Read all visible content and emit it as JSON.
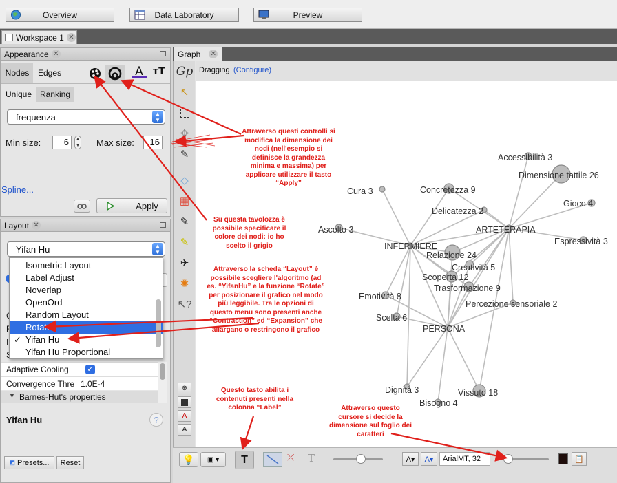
{
  "top": {
    "overview": "Overview",
    "data_lab": "Data Laboratory",
    "preview": "Preview"
  },
  "workspace": {
    "tab": "Workspace 1"
  },
  "appearance": {
    "title": "Appearance",
    "nodes": "Nodes",
    "edges": "Edges",
    "unique": "Unique",
    "ranking": "Ranking",
    "attribute": "frequenza",
    "min_label": "Min size:",
    "min_value": "6",
    "max_label": "Max size:",
    "max_value": "16",
    "spline": "Spline...",
    "apply": "Apply"
  },
  "layout": {
    "title": "Layout",
    "selected": "Yifan Hu",
    "menu": [
      "Isometric Layout",
      "Label Adjust",
      "Noverlap",
      "OpenOrd",
      "Random Layout",
      "Rotate",
      "Yifan Hu",
      "Yifan Hu Proportional"
    ],
    "highlighted": "Rotate",
    "checked": "Yifan Hu",
    "adaptive": "Adaptive Cooling",
    "convergence_key": "Convergence Thre",
    "convergence_val": "1.0E-4",
    "barnes": "Barnes-Hut's properties",
    "algo_title": "Yifan Hu",
    "help": "?",
    "presets": "Presets...",
    "reset": "Reset"
  },
  "graph": {
    "title": "Graph",
    "dragging": "Dragging",
    "configure": "(Configure)",
    "font_label": "ArialMT, 32"
  },
  "nodes": [
    {
      "id": "accessibilita",
      "label": "Accessibilità  3"
    },
    {
      "id": "dimensione",
      "label": "Dimensione tattile  26"
    },
    {
      "id": "concretezza",
      "label": "Concretezza  9"
    },
    {
      "id": "cura",
      "label": "Cura  3"
    },
    {
      "id": "gioco",
      "label": "Gioco  4"
    },
    {
      "id": "delicatezza",
      "label": "Delicatezza  2"
    },
    {
      "id": "arteterapia",
      "label": "ARTETERAPIA"
    },
    {
      "id": "ascolto",
      "label": "Ascolto  3"
    },
    {
      "id": "espressivita",
      "label": "Espressività  3"
    },
    {
      "id": "infermiere",
      "label": "INFERMIERE"
    },
    {
      "id": "relazione",
      "label": "Relazione  24"
    },
    {
      "id": "creativita",
      "label": "Creatività  5"
    },
    {
      "id": "scoperta",
      "label": "Scoperta  12"
    },
    {
      "id": "trasformazione",
      "label": "Trasformazione  9"
    },
    {
      "id": "emotivita",
      "label": "Emotività  8"
    },
    {
      "id": "percezione",
      "label": "Percezione sensoriale  2"
    },
    {
      "id": "scelta",
      "label": "Scelta  6"
    },
    {
      "id": "persona",
      "label": "PERSONA"
    },
    {
      "id": "dignita",
      "label": "Dignità  3"
    },
    {
      "id": "vissuto",
      "label": "Vissuto  18"
    },
    {
      "id": "bisogno",
      "label": "Bisogno  4"
    }
  ],
  "annotations": {
    "a1": "Attraverso questi controlli si modifica la dimensione dei nodi (nell'esempio si definisce la grandezza minima e massima) per applicare utilizzare il tasto “Apply”",
    "a2": "Su questa tavolozza è possibile specificare il colore dei nodi: io ho scelto il grigio",
    "a3": "Attraverso la scheda “Layout” è possibile scegliere l'algoritmo (ad es. “YifanHu” e la funzione “Rotate” per posizionare il grafico nel modo più leggibile. Tra le opzioni di questo menu sono presenti anche “Contraction” ed “Expansion” che allargano o restringono il grafico",
    "a4": "Questo tasto abilita i contenuti presenti nella colonna “Label”",
    "a5": "Attraverso questo cursore si decide la dimensione sul foglio dei caratteri"
  },
  "colors": {
    "annotation": "#e0201b",
    "selection": "#2f6ee2",
    "link": "#2255cc",
    "node": "#bdbdbd"
  }
}
